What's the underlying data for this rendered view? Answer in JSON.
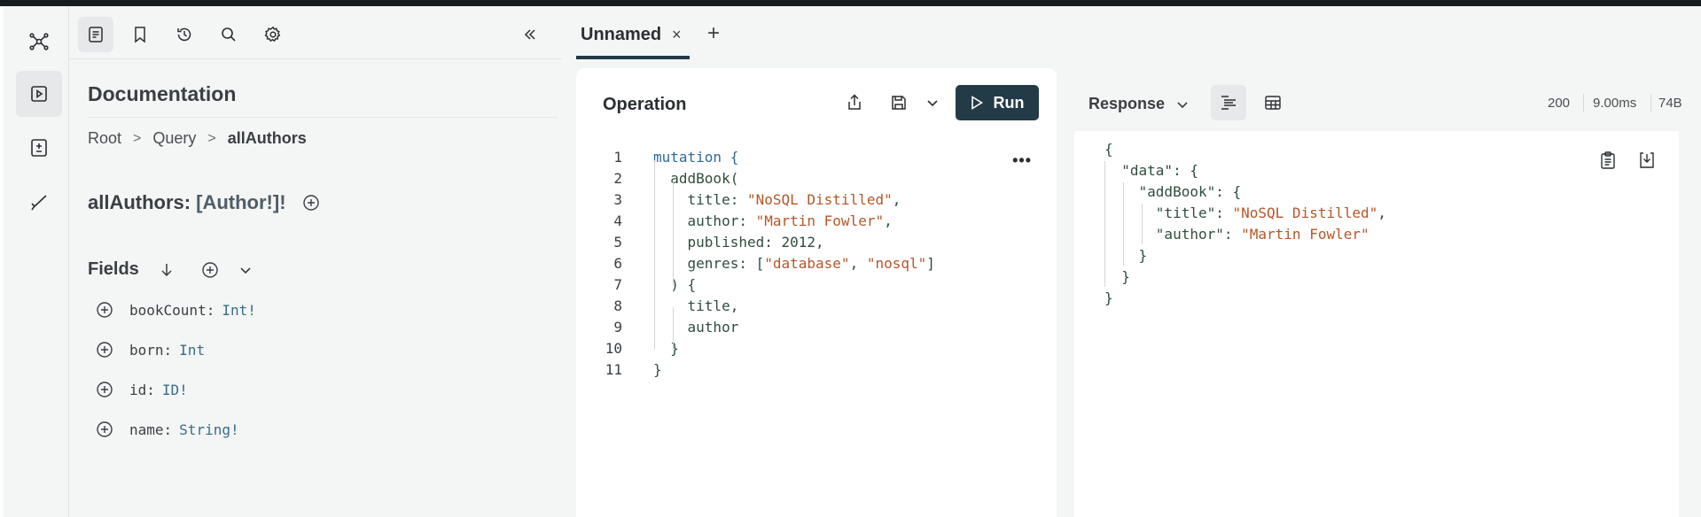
{
  "sidebar": {
    "buttons": [
      {
        "name": "schema-graph-icon",
        "active": false
      },
      {
        "name": "play-icon",
        "active": true
      },
      {
        "name": "plus-minus-icon",
        "active": false
      },
      {
        "name": "checkmark-icon",
        "active": false
      }
    ]
  },
  "docs_toolbar": {
    "icons": [
      "document-icon",
      "bookmark-icon",
      "history-icon",
      "search-icon",
      "gear-icon"
    ],
    "collapse_icon": "double-chevron-left-icon"
  },
  "docs": {
    "title": "Documentation",
    "breadcrumb": [
      "Root",
      "Query",
      "allAuthors"
    ],
    "field_name": "allAuthors:",
    "field_type": "[Author!]!",
    "fields_label": "Fields",
    "fields": [
      {
        "name": "bookCount:",
        "type": "Int!"
      },
      {
        "name": "born:",
        "type": "Int"
      },
      {
        "name": "id:",
        "type": "ID!"
      },
      {
        "name": "name:",
        "type": "String!"
      }
    ]
  },
  "tabs": {
    "active_label": "Unnamed",
    "close": "×",
    "add": "+"
  },
  "operation": {
    "title": "Operation",
    "run_label": "Run",
    "more": "•••",
    "line_numbers": [
      "1",
      "2",
      "3",
      "4",
      "5",
      "6",
      "7",
      "8",
      "9",
      "10",
      "11"
    ],
    "lines": [
      [
        {
          "t": "mutation",
          "c": "kw"
        },
        {
          "t": " {",
          "c": "kw"
        }
      ],
      [
        {
          "t": "  addBook(",
          "c": ""
        }
      ],
      [
        {
          "t": "    title: ",
          "c": ""
        },
        {
          "t": "\"NoSQL Distilled\"",
          "c": "str"
        },
        {
          "t": ",",
          "c": ""
        }
      ],
      [
        {
          "t": "    author: ",
          "c": ""
        },
        {
          "t": "\"Martin Fowler\"",
          "c": "str"
        },
        {
          "t": ",",
          "c": ""
        }
      ],
      [
        {
          "t": "    published: ",
          "c": ""
        },
        {
          "t": "2012",
          "c": "num"
        },
        {
          "t": ",",
          "c": ""
        }
      ],
      [
        {
          "t": "    genres: [",
          "c": ""
        },
        {
          "t": "\"database\"",
          "c": "str"
        },
        {
          "t": ", ",
          "c": ""
        },
        {
          "t": "\"nosql\"",
          "c": "str"
        },
        {
          "t": "]",
          "c": ""
        }
      ],
      [
        {
          "t": "  ) {",
          "c": ""
        }
      ],
      [
        {
          "t": "    title,",
          "c": ""
        }
      ],
      [
        {
          "t": "    author",
          "c": ""
        }
      ],
      [
        {
          "t": "  }",
          "c": ""
        }
      ],
      [
        {
          "t": "}",
          "c": ""
        }
      ]
    ]
  },
  "response": {
    "label": "Response",
    "status": "200",
    "time": "9.00ms",
    "size": "74B",
    "lines": [
      [
        {
          "t": "{",
          "c": ""
        }
      ],
      [
        {
          "t": "  \"data\": {",
          "c": ""
        }
      ],
      [
        {
          "t": "    \"addBook\": {",
          "c": ""
        }
      ],
      [
        {
          "t": "      \"title\": ",
          "c": ""
        },
        {
          "t": "\"NoSQL Distilled\"",
          "c": "str"
        },
        {
          "t": ",",
          "c": ""
        }
      ],
      [
        {
          "t": "      \"author\": ",
          "c": ""
        },
        {
          "t": "\"Martin Fowler\"",
          "c": "str"
        }
      ],
      [
        {
          "t": "    }",
          "c": ""
        }
      ],
      [
        {
          "t": "  }",
          "c": ""
        }
      ],
      [
        {
          "t": "}",
          "c": ""
        }
      ]
    ]
  }
}
